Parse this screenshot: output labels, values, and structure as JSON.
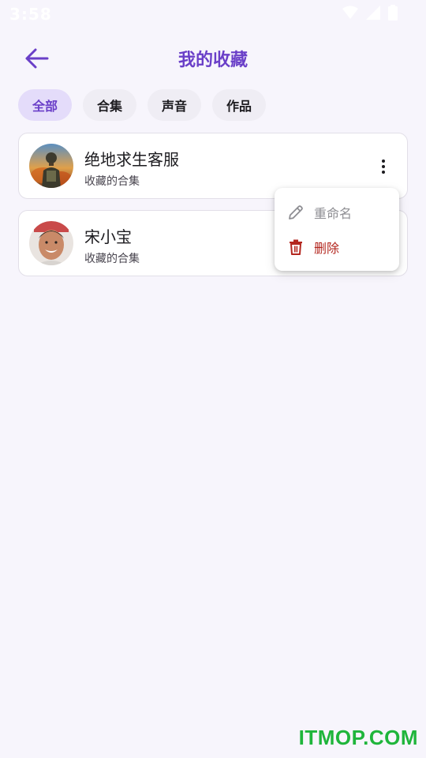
{
  "status_bar": {
    "time": "3:58"
  },
  "header": {
    "title": "我的收藏",
    "back_icon": "arrow-left-icon"
  },
  "filters": [
    {
      "label": "全部",
      "active": true
    },
    {
      "label": "合集",
      "active": false
    },
    {
      "label": "声音",
      "active": false
    },
    {
      "label": "作品",
      "active": false
    }
  ],
  "items": [
    {
      "title": "绝地求生客服",
      "subtitle": "收藏的合集"
    },
    {
      "title": "宋小宝",
      "subtitle": "收藏的合集"
    }
  ],
  "context_menu": {
    "rename_label": "重命名",
    "delete_label": "删除"
  },
  "watermark": "ITMOP.COM",
  "colors": {
    "accent": "#6a3fc8",
    "chip_active_bg": "#e4dcfa",
    "danger": "#b3261e",
    "background": "#f7f5fc"
  }
}
